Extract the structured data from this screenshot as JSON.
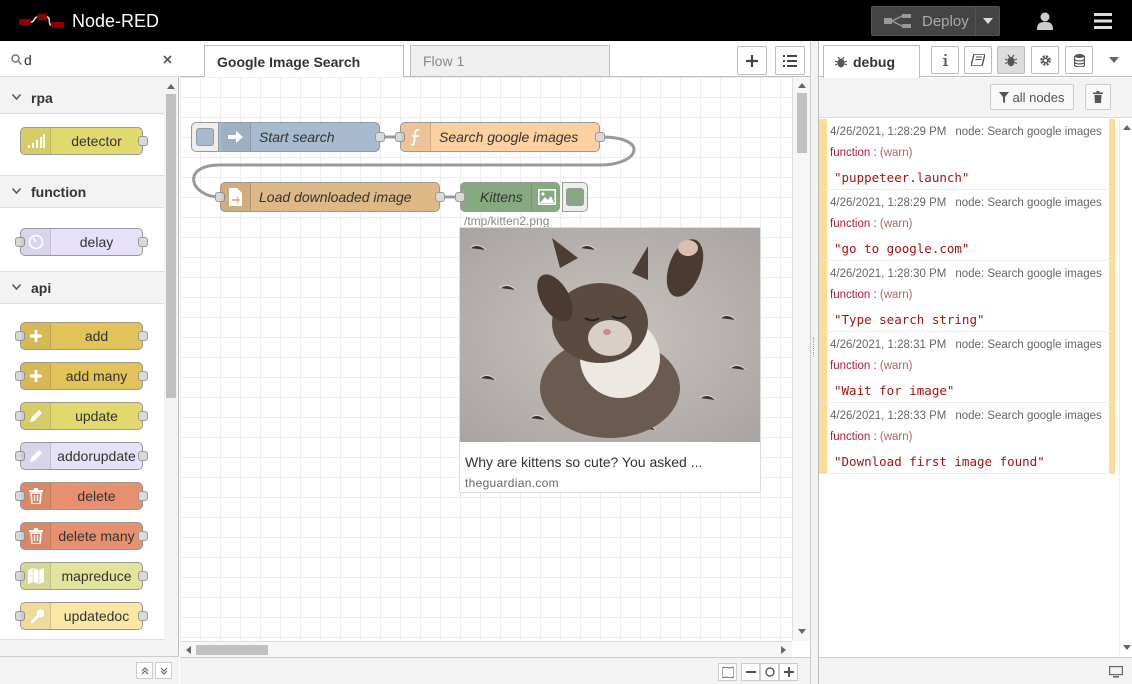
{
  "header": {
    "app_name": "Node-RED",
    "deploy_label": "Deploy"
  },
  "palette": {
    "search_value": "d",
    "categories": [
      {
        "name": "rpa",
        "nodes": [
          {
            "label": "detector",
            "color": "#e2d96e",
            "icon": "signal-bars-icon"
          }
        ]
      },
      {
        "name": "function",
        "nodes": [
          {
            "label": "delay",
            "color": "#e6e0f8",
            "icon": "timer-icon"
          }
        ]
      },
      {
        "name": "api",
        "nodes": [
          {
            "label": "add",
            "color": "#e2c359",
            "icon": "plus-icon"
          },
          {
            "label": "add many",
            "color": "#e2c359",
            "icon": "plus-icon"
          },
          {
            "label": "update",
            "color": "#e2d96e",
            "icon": "pencil-icon"
          },
          {
            "label": "addorupdate",
            "color": "#e6e0f8",
            "icon": "pencil-icon"
          },
          {
            "label": "delete",
            "color": "#e7906f",
            "icon": "trash-icon"
          },
          {
            "label": "delete many",
            "color": "#e7906f",
            "icon": "trash-icon"
          },
          {
            "label": "mapreduce",
            "color": "#e2e39c",
            "icon": "map-icon"
          },
          {
            "label": "updatedoc",
            "color": "#fce6a4",
            "icon": "wrench-icon"
          }
        ]
      }
    ]
  },
  "workspace": {
    "tabs": [
      {
        "label": "Google Image Search",
        "active": true
      },
      {
        "label": "Flow 1",
        "active": false
      }
    ],
    "nodes": {
      "start_search": {
        "label": "Start search",
        "color": "#a6bbcf"
      },
      "search_google": {
        "label": "Search google images",
        "color": "#fdd0a2"
      },
      "load_image": {
        "label": "Load downloaded image",
        "color": "#deb887"
      },
      "kittens": {
        "label": "Kittens",
        "color": "#87a980"
      }
    },
    "image_preview": {
      "path": "/tmp/kitten2.png",
      "caption": "Why are kittens so cute? You asked ...",
      "source": "theguardian.com"
    }
  },
  "sidebar": {
    "active_tab": "debug",
    "filter_label": "all nodes",
    "messages": [
      {
        "timestamp": "4/26/2021, 1:28:29 PM",
        "node": "node: Search google images",
        "topic": "function : ",
        "level": "(warn)",
        "body": "\"puppeteer.launch\""
      },
      {
        "timestamp": "4/26/2021, 1:28:29 PM",
        "node": "node: Search google images",
        "topic": "function : ",
        "level": "(warn)",
        "body": "\"go to google.com\""
      },
      {
        "timestamp": "4/26/2021, 1:28:30 PM",
        "node": "node: Search google images",
        "topic": "function : ",
        "level": "(warn)",
        "body": "\"Type search string\""
      },
      {
        "timestamp": "4/26/2021, 1:28:31 PM",
        "node": "node: Search google images",
        "topic": "function : ",
        "level": "(warn)",
        "body": "\"Wait for image\""
      },
      {
        "timestamp": "4/26/2021, 1:28:33 PM",
        "node": "node: Search google images",
        "topic": "function : ",
        "level": "(warn)",
        "body": "\"Download first image found\""
      }
    ]
  }
}
